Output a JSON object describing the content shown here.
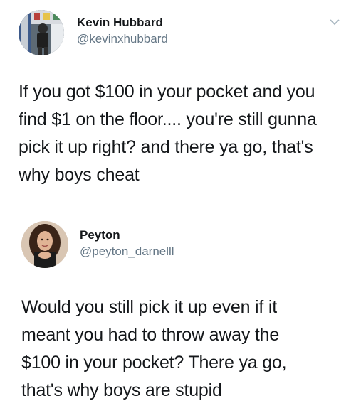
{
  "tweets": [
    {
      "name": "Kevin Hubbard",
      "handle": "@kevinxhubbard",
      "lines": [
        "If you got $100 in your pocket and you",
        "find $1 on the floor.... you're still gunna",
        "pick it up right? and there ya go, that's",
        "why boys cheat"
      ],
      "menu_icon": "chevron-down-icon"
    },
    {
      "name": "Peyton",
      "handle": "@peyton_darnelll",
      "lines": [
        "Would you still pick it up even if it",
        "meant you had to throw away the",
        "$100 in your pocket? There ya go,",
        "that's why boys are stupid"
      ]
    }
  ],
  "colors": {
    "text": "#14171a",
    "handle": "#657786",
    "chevron": "#aab8c2"
  }
}
